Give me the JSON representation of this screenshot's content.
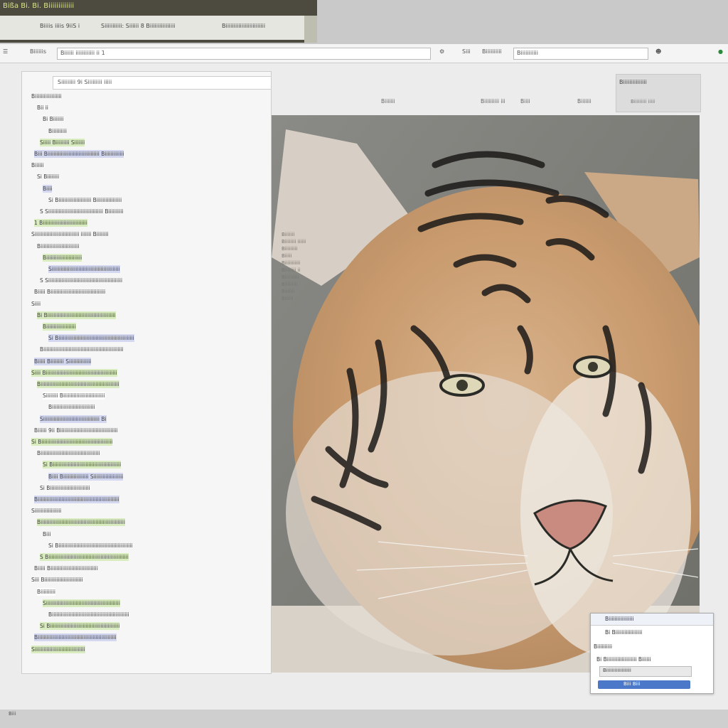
{
  "top_window": {
    "title": "Bißa Bi. Bi. Biiiiiiiiiiiii",
    "bar": [
      "Biiiis iiiis 9iiS i",
      "Siiiiiiiiiii: Siiiiii 8 Biiiiiiiiiiiiiiii",
      "Biiiiiiiiiiiiiiiiiiiiiiiii"
    ]
  },
  "toolbar": {
    "back_label": "Biiiiiis",
    "address": "Biiiiii iiiiiiiiiiii ii 1",
    "nav_label": "Siii",
    "tools_label": "Biiiiiiiiii",
    "search_placeholder": "Biiiiiiiiiii"
  },
  "left_panel": {
    "header": "Siiiiiiiii 9i  Siiiiiiiii iiiii",
    "lines": [
      {
        "text": "Biiiiiiiiiiiiiiiiii",
        "hl": ""
      },
      {
        "text": "Bii ii",
        "hl": ""
      },
      {
        "text": "Bi Biiiiiii",
        "hl": ""
      },
      {
        "text": "Biiiiiiiiii",
        "hl": ""
      },
      {
        "text": "Siiiii Biiiiiiiii Siiiiiii",
        "hl": "green"
      },
      {
        "text": "Biii Biiiiiiiiiiiiiiiiiiiiiiiiiiiiiiiiiii Biiiiiiiiiiiii",
        "hl": "blue"
      },
      {
        "text": "Biiiiii",
        "hl": ""
      },
      {
        "text": "Si   Biiiiiiii",
        "hl": ""
      },
      {
        "text": "Biiii",
        "hl": "blue"
      },
      {
        "text": "Si Biiiiiiiiiiiiiiiiiiiiii Biiiiiiiiiiiiiiiii",
        "hl": ""
      },
      {
        "text": "S Siiiiiiiiiiiiiiiiiiiiiiiiiiiiiiiiiiiii Biiiiiiiiii",
        "hl": ""
      },
      {
        "text": "1 Biiiiiiiiiiiiiiiiiiiiiiiiiiiiii",
        "hl": "green"
      },
      {
        "text": "Siiiiiiiiiiiiiiiiiiiiiiiiiiiiii iiiiiii Biiiiiiii",
        "hl": ""
      },
      {
        "text": "Biiiiiiiiiiiiiiiiiiiiiiiiii",
        "hl": ""
      },
      {
        "text": "Biiiiiiiiiiiiiiiiiiiiiiii",
        "hl": "green"
      },
      {
        "text": "Siiiiiiiiiiiiiiiiiiiiiiiiiiiiiiiiiiiiiiiiiiiiii",
        "hl": "blue"
      },
      {
        "text": "S Siiiiiiiiiiiiiiiiiiiiiiiiiiiiiiiiiiiiiiiiiiiiiiiiii",
        "hl": ""
      },
      {
        "text": "Biiiii Biiiiiiiiiiiiiiiiiiiiiiiiiiiiiiiiiiiii",
        "hl": ""
      },
      {
        "text": "Siiii",
        "hl": ""
      },
      {
        "text": "Bi Biiiiiiiiiiiiiiiiiiiiiiiiiiiiiiiiiiiiiiiiiiiiii",
        "hl": "green"
      },
      {
        "text": "Biiiiiiiiiiiiiiiiiiii",
        "hl": "green"
      },
      {
        "text": "Si Biiiiiiiiiiiiiiiiiiiiiiiiiiiiiiiiiiiiiiiiiiiiiiiiiii",
        "hl": "blue"
      },
      {
        "text": "Biiiiiiiiiiiiiiiiiiiiiiiiiiiiiiiiiiiiiiiiiiiiiiiiiiiiii",
        "hl": ""
      },
      {
        "text": "Biiiii Biiiiiiiii Siiiiiiiiiiiiiii",
        "hl": "blue"
      },
      {
        "text": "Siiii Biiiiiiiiiiiiiiiiiiiiiiiiiiiiiiiiiiiiiiiiiiiiiiii",
        "hl": "green"
      },
      {
        "text": "Biiiiiiiiiiiiiiiiiiiiiiiiiiiiiiiiiiiiiiiiiiiiiiiiiiiii",
        "hl": "green"
      },
      {
        "text": "Siiiiiiii Biiiiiiiiiiiiiiiiiiiiiiiiiiii",
        "hl": "white"
      },
      {
        "text": "Biiiiiiiiiiiiiiiiiiiiiiiiiiiii",
        "hl": ""
      },
      {
        "text": "Siiiiiiiiiiiiiiiiiiiiiiiiiiiiiiiiiiiiii Bi",
        "hl": "blue"
      },
      {
        "text": "Biiiiii 9ii Biiiiiiiiiiiiiiiiiiiiiiiiiiiiiiiiiiiiiii",
        "hl": ""
      },
      {
        "text": "Si Biiiiiiiiiiiiiiiiiiiiiiiiiiiiiiiiiiiiiiiiiiiiiiii",
        "hl": "green"
      },
      {
        "text": "Biiiiiiiiiiiiiiiiiiiiiiiiiiiiiiiiiiiiiiii",
        "hl": ""
      },
      {
        "text": "Si Biiiiiiiiiiiiiiiiiiiiiiiiiiiiiiiiiiiiiiiiiiiiii",
        "hl": "green"
      },
      {
        "text": "Biiii Biiiiiiiiiiiiiiiii Siiiiiiiiiiiiiiiiiiii",
        "hl": "blue"
      },
      {
        "text": "Si Biiiiiiiiiiiiiiiiiiiiiiiiiii",
        "hl": ""
      },
      {
        "text": "Biiiiiiiiiiiiiiiiiiiiiiiiiiiiiiiiiiiiiiiiiiiiiiiiiiiiiii",
        "hl": "blue"
      },
      {
        "text": "Siiiiiiiiiiiiiiiiii",
        "hl": ""
      },
      {
        "text": "Biiiiiiiiiiiiiiiiiiiiiiiiiiiiiiiiiiiiiiiiiiiiiiiiiiiiiiiii",
        "hl": "green"
      },
      {
        "text": "Biii",
        "hl": ""
      },
      {
        "text": "Si Biiiiiiiiiiiiiiiiiiiiiiiiiiiiiiiiiiiiiiiiiiiiiiiiii",
        "hl": ""
      },
      {
        "text": "S Biiiiiiiiiiiiiiiiiiiiiiiiiiiiiiiiiiiiiiiiiiiiiiiiiiiiii",
        "hl": "green"
      },
      {
        "text": "Biiiii Biiiiiiiiiiiiiiiiiiiiiiiiiiiiiiii",
        "hl": ""
      },
      {
        "text": "Siii Biiiiiiiiiiiiiiiiiiiiiiiiii",
        "hl": ""
      },
      {
        "text": "Biiiiiiiiii",
        "hl": "white"
      },
      {
        "text": "Siiiiiiiiiiiiiiiiiiiiiiiiiiiiiiiiiiiiiiiiiiiiiiiiii",
        "hl": "green"
      },
      {
        "text": "Biiiiiiiiiiiiiiiiiiiiiiiiiiiiiiiiiiiiiiiiiiiiiiiiiiii",
        "hl": ""
      },
      {
        "text": "Si Biiiiiiiiiiiiiiiiiiiiiiiiiiiiiiiiiiiiiiiiiiiiiii",
        "hl": "green"
      },
      {
        "text": "Biiiiiiiiiiiiiiiiiiiiiiiiiiiiiiiiiiiiiiiiiiiiiiiiiiiii",
        "hl": "blue"
      },
      {
        "text": "Siiiiiiiiiiiiiiiiiiiiiiiiiiiiiiiiii",
        "hl": "green"
      }
    ]
  },
  "image_view": {
    "header": [
      "Biiiiiii",
      "Biiiiiiiiii iii",
      "Biiii",
      "Biiiiiii"
    ],
    "thumb_title": "Biiiiiiiiiiiiiii",
    "thumb_sub": "Biiiiiiiii iiiii",
    "overlay": [
      "Biiiiiii",
      "Biiiiiiii iiiiii",
      "Biiiiiiiii",
      "Biiiii",
      "Biiiiiiiiiii",
      "Biiiiiiii ii",
      "Biiiiiiiiii",
      "Biiiiiiiii",
      "Biiiiiii",
      "Biiiiii"
    ]
  },
  "dialog": {
    "title": "Biiiiiiiiiiiiiiiii",
    "line1": "Bi Biiiiiiiiiiiiiiiiii",
    "line2": "Biiiiiiiiii",
    "line3": "Bi Biiiiiiiiiiiiiiiiiiii Biiiiii",
    "field": "Biiiiiiiiiiiiiiiiii",
    "button": "Biii  Biii"
  },
  "status": {
    "text": "Biii"
  }
}
